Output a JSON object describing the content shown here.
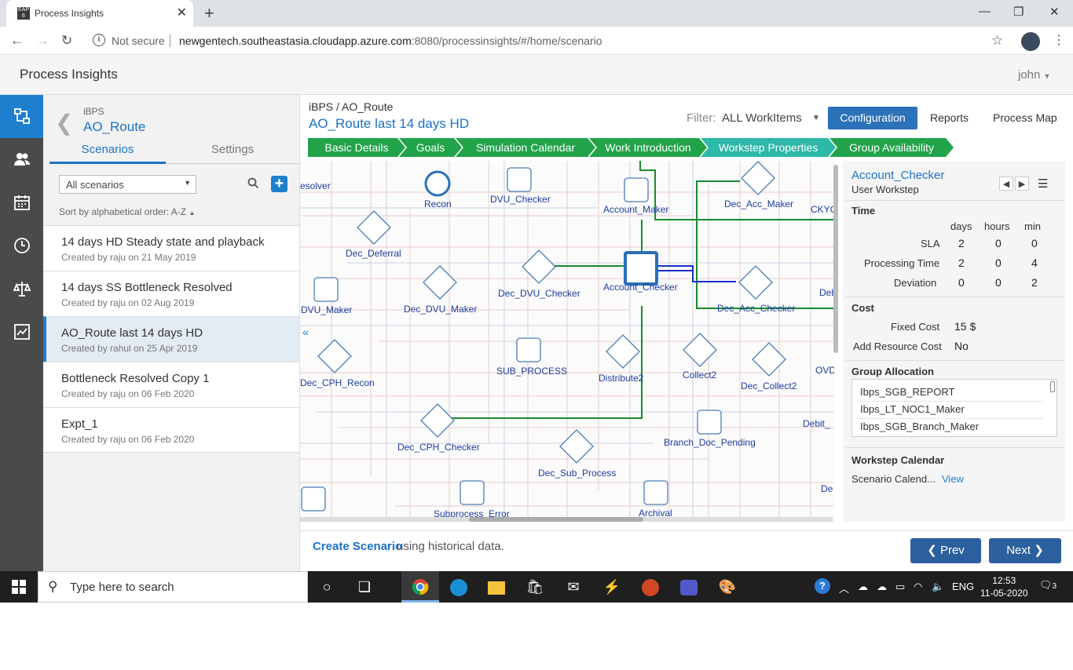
{
  "browser": {
    "tab_title": "Process Insights",
    "favicon_text": "EAP 6",
    "security_label": "Not secure",
    "url_host": "newgentech.southeastasia.cloudapp.azure.com",
    "url_rest": ":8080/processinsights/#/home/scenario"
  },
  "app": {
    "title": "Process Insights",
    "user": "john"
  },
  "left_panel": {
    "breadcrumb": "iBPS",
    "route": "AO_Route",
    "tabs": [
      "Scenarios",
      "Settings"
    ],
    "scenario_filter": "All scenarios",
    "sort_label": "Sort by alphabetical order: A-Z",
    "scenarios": [
      {
        "name": "14 days HD Steady state and playback",
        "meta": "Created by raju on 21 May 2019"
      },
      {
        "name": "14 days SS Bottleneck Resolved",
        "meta": "Created by raju on 02 Aug 2019"
      },
      {
        "name": "AO_Route last 14 days HD",
        "meta": "Created by rahul on 25 Apr 2019"
      },
      {
        "name": "Bottleneck Resolved Copy 1",
        "meta": "Created by raju on 06 Feb 2020"
      },
      {
        "name": "Expt_1",
        "meta": "Created by raju on 06 Feb 2020"
      }
    ]
  },
  "main": {
    "breadcrumb": "iBPS / AO_Route",
    "title": "AO_Route last 14 days HD",
    "filter_label": "Filter:",
    "filter_value": "ALL WorkItems",
    "config_btn": "Configuration",
    "reports_btn": "Reports",
    "processmap_btn": "Process Map",
    "steps": [
      "Basic Details",
      "Goals",
      "Simulation Calendar",
      "Work Introduction",
      "Workstep Properties",
      "Group Availability"
    ],
    "step_colors": [
      "#22a34a",
      "#22a34a",
      "#22a34a",
      "#22a34a",
      "#2db8a8",
      "#22a34a"
    ]
  },
  "canvas_nodes": [
    {
      "label": "esolver"
    },
    {
      "label": "Recon"
    },
    {
      "label": "DVU_Checker"
    },
    {
      "label": "Account_Maker"
    },
    {
      "label": "Dec_Acc_Maker"
    },
    {
      "label": "CKYC"
    },
    {
      "label": "Dec_Deferral"
    },
    {
      "label": "Dec_DVU_Checker"
    },
    {
      "label": "Account_Checker"
    },
    {
      "label": "Dec_Acc_Checker"
    },
    {
      "label": "Deb"
    },
    {
      "label": "DVU_Maker"
    },
    {
      "label": "Dec_DVU_Maker"
    },
    {
      "label": "Dec_CPH_Recon"
    },
    {
      "label": "SUB_PROCESS"
    },
    {
      "label": "Distribute2"
    },
    {
      "label": "Collect2"
    },
    {
      "label": "Dec_Collect2"
    },
    {
      "label": "OVD"
    },
    {
      "label": "Dec_CPH_Checker"
    },
    {
      "label": "Branch_Doc_Pending"
    },
    {
      "label": "Debit_"
    },
    {
      "label": "Dec_Sub_Process"
    },
    {
      "label": "Subprocess_Error"
    },
    {
      "label": "Archival"
    },
    {
      "label": "De"
    }
  ],
  "props": {
    "name": "Account_Checker",
    "type": "User Workstep",
    "time_label": "Time",
    "cols": [
      "days",
      "hours",
      "min"
    ],
    "rows": [
      {
        "label": "SLA",
        "v": [
          "2",
          "0",
          "0"
        ]
      },
      {
        "label": "Processing Time",
        "v": [
          "2",
          "0",
          "4"
        ]
      },
      {
        "label": "Deviation",
        "v": [
          "0",
          "0",
          "2"
        ]
      }
    ],
    "cost_label": "Cost",
    "fixed_cost_label": "Fixed Cost",
    "fixed_cost_value": "15 $",
    "add_res_label": "Add Resource Cost",
    "add_res_value": "No",
    "group_label": "Group Allocation",
    "groups": [
      "Ibps_SGB_REPORT",
      "Ibps_LT_NOC1_Maker",
      "Ibps_SGB_Branch_Maker"
    ],
    "calendar_label": "Workstep Calendar",
    "calendar_value": "Scenario Calend...",
    "view_link": "View"
  },
  "bottom": {
    "create_link": "Create Scenario",
    "create_rest": "using historical data.",
    "prev_btn": "Prev",
    "next_btn": "Next"
  },
  "taskbar": {
    "search_placeholder": "Type here to search",
    "lang": "ENG",
    "time": "12:53",
    "date": "11-05-2020",
    "notif_count": "3"
  }
}
